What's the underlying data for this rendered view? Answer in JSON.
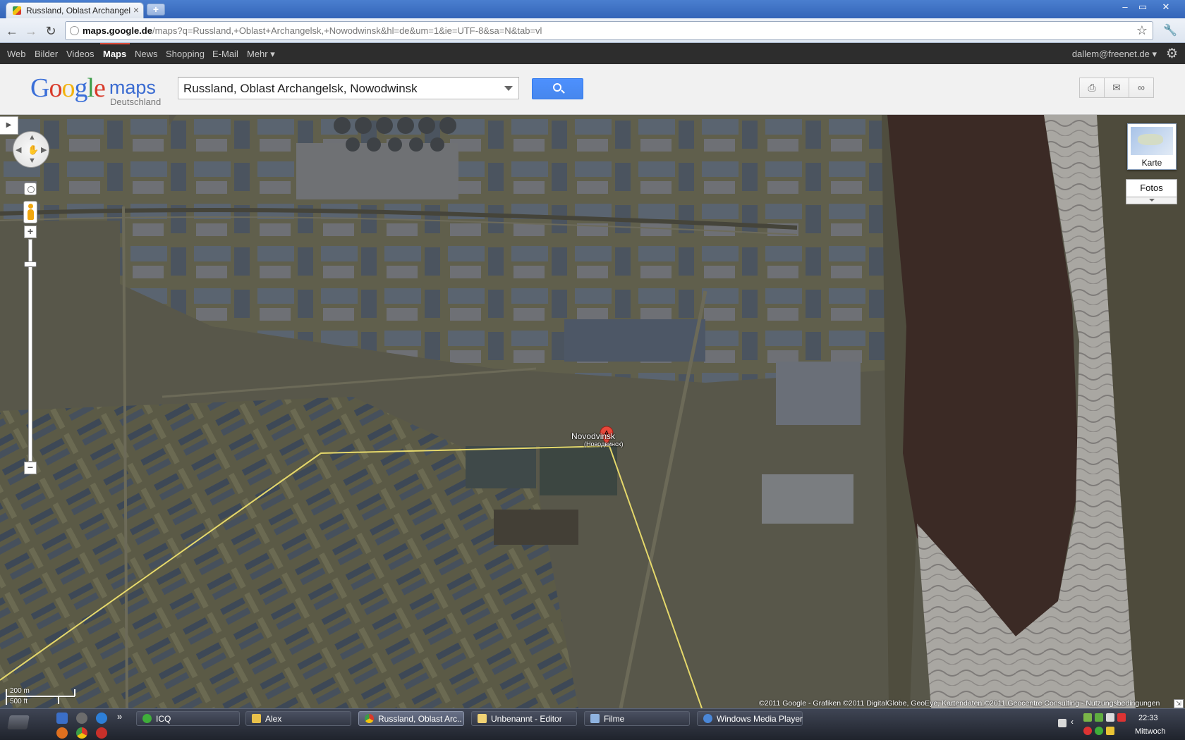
{
  "browser": {
    "tab_title": "Russland, Oblast Archangel",
    "close_glyph": "×",
    "new_tab_glyph": "+",
    "url_host": "maps.google.de",
    "url_path": "/maps?q=Russland,+Oblast+Archangelsk,+Nowodwinsk&hl=de&um=1&ie=UTF-8&sa=N&tab=vl",
    "window_controls": [
      "–",
      "▭",
      "✕"
    ]
  },
  "gbar": {
    "items": [
      "Web",
      "Bilder",
      "Videos",
      "Maps",
      "News",
      "Shopping",
      "E-Mail",
      "Mehr ▾"
    ],
    "active": "Maps",
    "user": "dallem@freenet.de ▾"
  },
  "maps_header": {
    "logo_google": "Google",
    "logo_maps": "maps",
    "logo_country": "Deutschland",
    "search_query": "Russland, Oblast Archangelsk, Nowodwinsk"
  },
  "map": {
    "map_type_button": "Karte",
    "layer_button": "Fotos",
    "marker_letter": "A",
    "marker_label": "Novodvinsk",
    "marker_sublabel": "(Новодвинск)",
    "scale_metric": "200 m",
    "scale_imperial": "500 ft",
    "copyright": "©2011 Google - Grafiken ©2011 DigitalGlobe, GeoEye, Kartendaten ©2011 Geocentre Consulting - Nutzungsbedingungen",
    "zoom_in": "+",
    "zoom_out": "−"
  },
  "taskbar": {
    "tasks": [
      {
        "label": "ICQ",
        "color": "#3fae3a"
      },
      {
        "label": "Alex",
        "color": "#e8c04a"
      },
      {
        "label": "Russland, Oblast Arc...",
        "color": "#d9412f"
      },
      {
        "label": "Unbenannt - Editor",
        "color": "#f0d274"
      },
      {
        "label": "Filme",
        "color": "#8fb3e0"
      },
      {
        "label": "Windows Media Player",
        "color": "#4a87d8"
      }
    ],
    "overflow_glyph": "»",
    "clock": "22:33",
    "day": "Mittwoch"
  }
}
